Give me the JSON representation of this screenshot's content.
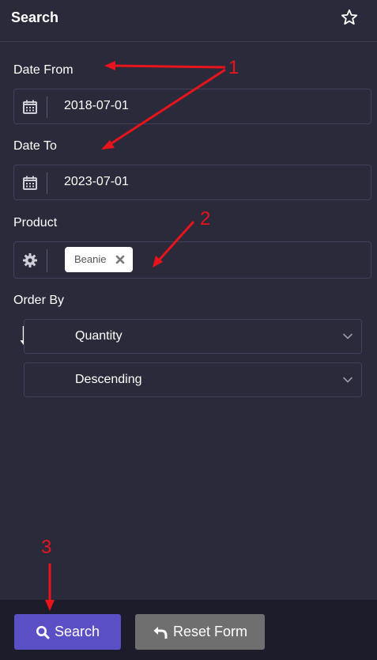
{
  "header": {
    "title": "Search",
    "favorite_icon": "star-icon"
  },
  "form": {
    "date_from": {
      "label": "Date From",
      "value": "2018-07-01",
      "icon": "calendar-icon"
    },
    "date_to": {
      "label": "Date To",
      "value": "2023-07-01",
      "icon": "calendar-icon"
    },
    "product": {
      "label": "Product",
      "icon": "gear-icon",
      "tags": [
        "Beanie"
      ]
    },
    "order_by": {
      "label": "Order By",
      "icon": "sort-alpha-down-icon",
      "field": "Quantity",
      "direction": "Descending"
    }
  },
  "footer": {
    "search_label": "Search",
    "reset_label": "Reset Form"
  },
  "annotations": {
    "marker_1": "1",
    "marker_2": "2",
    "marker_3": "3",
    "color": "#e8141b"
  },
  "colors": {
    "background": "#2a2a3b",
    "footer_background": "#1c1c2a",
    "primary_button": "#5b4fc6",
    "secondary_button": "#6f6f6f"
  }
}
